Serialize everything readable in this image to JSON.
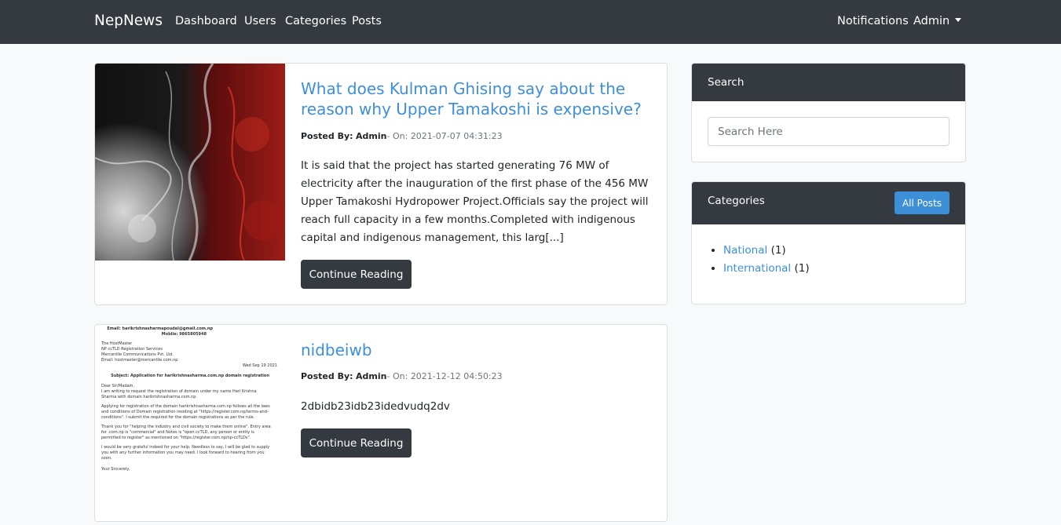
{
  "nav": {
    "brand": "NepNews",
    "links": [
      "Dashboard",
      "Users",
      "Categories",
      "Posts"
    ],
    "notifications": "Notifications",
    "admin": "Admin"
  },
  "posts": [
    {
      "title": "What does Kulman Ghising say about the reason why Upper Tamakoshi is expensive?",
      "posted_by_label": "Posted By:",
      "author": "Admin",
      "on_label": "- On:",
      "date": "2021-07-07 04:31:23",
      "excerpt": "It is said that the project has started generating 76 MW of electricity after the inauguration of the first phase of the 456 MW Upper Tamakoshi Hydropower Project.Officials say the project will reach full capacity in a few months.Completed with indigenous capital and indigenous management, this larg[...]",
      "button": "Continue Reading"
    },
    {
      "title": "nidbeiwb",
      "posted_by_label": "Posted By:",
      "author": "Admin",
      "on_label": "- On:",
      "date": "2021-12-12 04:50:23",
      "excerpt": "2dbidb23idb23idedvudq2dv",
      "button": "Continue Reading"
    }
  ],
  "document_image": {
    "email_line": "Email: harikrishnasharmapoudel@gmail.com.np",
    "mobile_line": "Mobile: 9865805948",
    "to_lines": [
      "The HostMaster",
      "NP ccTLD Registration Services",
      "Mercantile Communications Pvt. Ltd.",
      "Email: hostmaster@mercantile.com.np"
    ],
    "date": "Wed Sep 19 2021",
    "subject": "Subject: Application for harikrishnasharma.com.np domain registration",
    "salutation": "Dear Sir/Madam,",
    "body_1": "I am writing to request the registration of domain under my name Hari Krishna Sharma with domain harikrishnasharma.com.np.",
    "body_2": "Applying for registration of the domain harikrishnasharma.com.np follows all the laws and conditions of Domain registration residing at \"https://register.com.np/terms-and-conditions\". I submit the required for the domain registrations as per the rule.",
    "body_3": "Thank you for \"helping the industry and civil society to make them online\". Entry area for .com.np is \"commercial\" and Notes is \"open ccTLD, any person or entity is permitted to register\" as mentioned on \"https://register.com.np/np-ccTLDs\".",
    "body_4": "I would be very grateful indeed for your help. Needless to say, I will be glad to supply you with any further information you may need. I look forward to hearing from you soon.",
    "closing": "Your Sincerely,"
  },
  "sidebar": {
    "search_title": "Search",
    "search_placeholder": "Search Here",
    "categories_title": "Categories",
    "all_posts_button": "All Posts",
    "categories": [
      {
        "name": "National",
        "count": "(1)"
      },
      {
        "name": "International",
        "count": "(1)"
      }
    ]
  },
  "colors": {
    "navbar": "#343a40",
    "link": "#3d8fd8",
    "page_bg": "#f8f9fa"
  }
}
